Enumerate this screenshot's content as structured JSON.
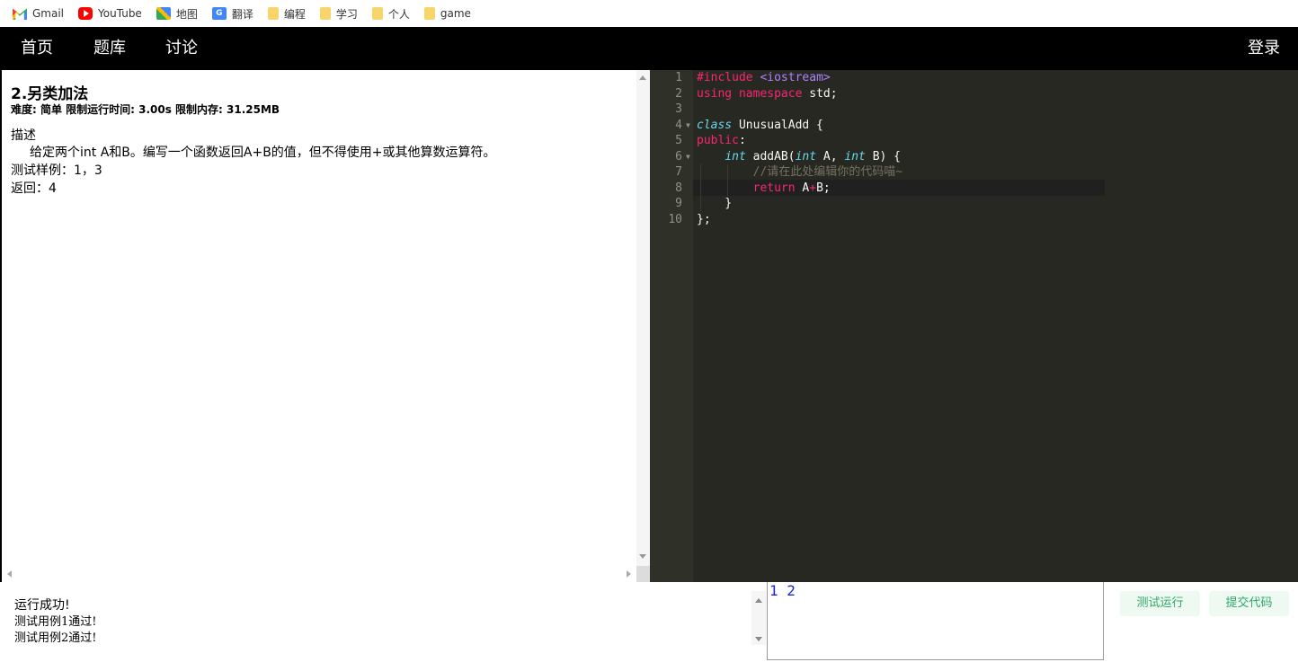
{
  "bookmarks": [
    {
      "label": "Gmail",
      "icon": "gmail-icon"
    },
    {
      "label": "YouTube",
      "icon": "youtube-icon"
    },
    {
      "label": "地图",
      "icon": "maps-icon"
    },
    {
      "label": "翻译",
      "icon": "translate-icon"
    },
    {
      "label": "编程",
      "icon": "folder-icon"
    },
    {
      "label": "学习",
      "icon": "folder-icon"
    },
    {
      "label": "个人",
      "icon": "folder-icon"
    },
    {
      "label": "game",
      "icon": "folder-icon"
    }
  ],
  "nav": {
    "home": "首页",
    "problems": "题库",
    "discuss": "讨论",
    "login": "登录"
  },
  "problem": {
    "title": "2.另类加法",
    "meta": "难度: 简单 限制运行时间: 3.00s 限制内存: 31.25MB",
    "desc_label": "描述",
    "desc_text": "给定两个int A和B。编写一个函数返回A+B的值，但不得使用+或其他算数运算符。",
    "sample_input": "测试样例：1，3",
    "sample_output": "返回：4"
  },
  "editor": {
    "line_numbers": [
      "1",
      "2",
      "3",
      "4",
      "5",
      "6",
      "7",
      "8",
      "9",
      "10"
    ],
    "lines": [
      "#include <iostream>",
      "using namespace std;",
      "",
      "class UnusualAdd {",
      "public:",
      "    int addAB(int A, int B) {",
      "        //请在此处编辑你的代码喵~",
      "        return A+B;",
      "    }",
      "};"
    ]
  },
  "output": {
    "status": "运行成功!",
    "case1": "测试用例1通过!",
    "case2": "测试用例2通过!"
  },
  "input": {
    "value": "1 2"
  },
  "buttons": {
    "test_run": "测试运行",
    "submit": "提交代码"
  },
  "colors": {
    "navbar_bg": "#000000",
    "editor_bg": "#272822",
    "button_text": "#2fa866",
    "input_text": "#1a27c9"
  }
}
